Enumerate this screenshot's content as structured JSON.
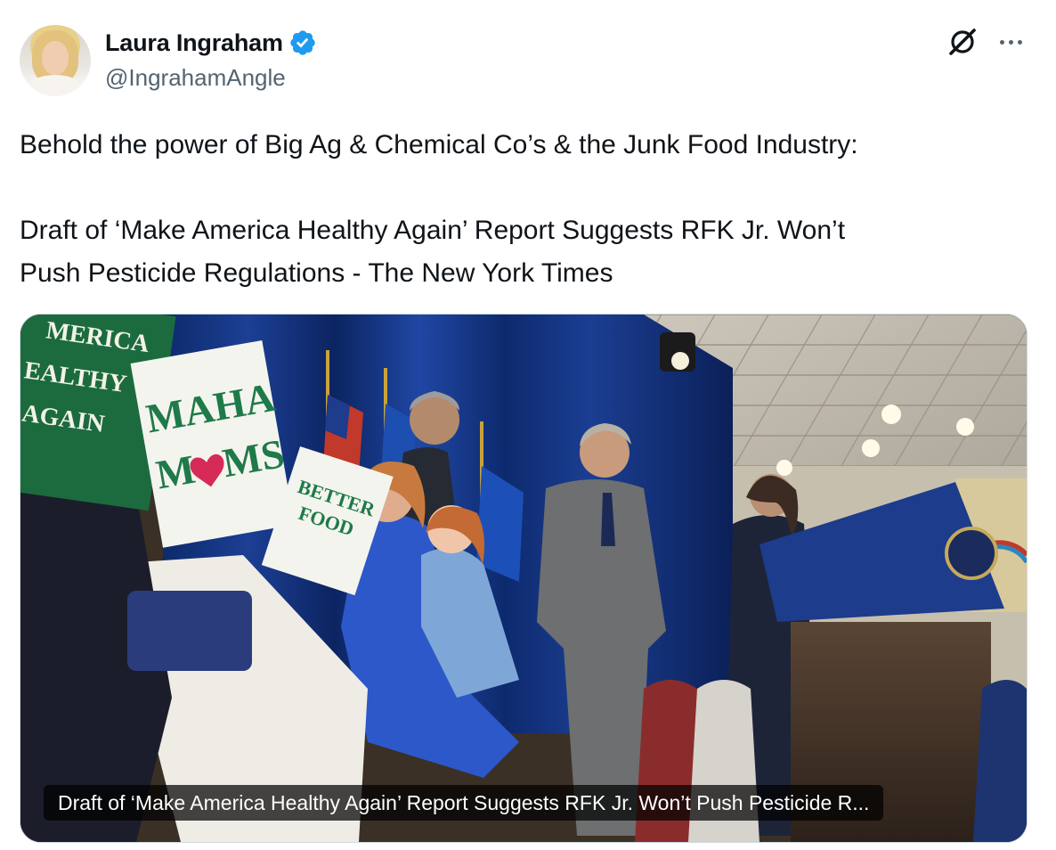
{
  "author": {
    "display_name": "Laura Ingraham",
    "handle": "@IngrahamAngle",
    "verified": true,
    "verified_color": "#1d9bf0"
  },
  "header_icons": [
    "grok-icon",
    "more-options-icon"
  ],
  "post": {
    "line1": "Behold the power of Big Ag & Chemical Co’s & the Junk Food Industry:",
    "line2": "Draft of ‘Make America Healthy Again’ Report Suggests RFK Jr. Won’t",
    "line3": "Push Pesticide Regulations - The New York Times"
  },
  "link_card": {
    "title": "Draft of ‘Make America Healthy Again’ Report Suggests RFK Jr. Won’t Push Pesticide R...",
    "photo_signs": {
      "sign1": [
        "MERICA",
        "EALTHY",
        "AGAIN"
      ],
      "sign2_top": "MAHA",
      "sign2_bottom_left": "M",
      "sign2_bottom_right": "MS",
      "sign3": [
        "BETTER",
        "FOOD"
      ]
    }
  },
  "colors": {
    "text_primary": "#0f1419",
    "text_secondary": "#536471",
    "border": "#cfd9de"
  }
}
